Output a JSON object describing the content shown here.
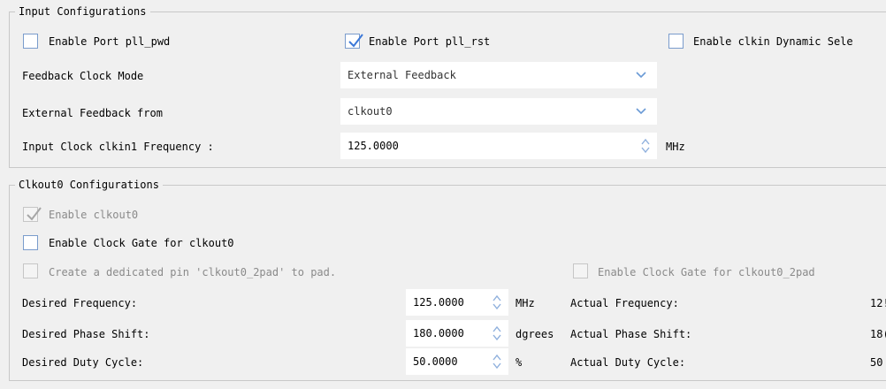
{
  "input_config": {
    "title": "Input Configurations",
    "enable_pll_pwd": {
      "label": "Enable Port pll_pwd",
      "checked": false
    },
    "enable_pll_rst": {
      "label": "Enable Port pll_rst",
      "checked": true
    },
    "enable_clkin_dyn": {
      "label": "Enable clkin Dynamic Sele",
      "checked": false
    },
    "feedback_mode_label": "Feedback Clock Mode",
    "feedback_mode_value": "External Feedback",
    "ext_feedback_label": "External Feedback from",
    "ext_feedback_value": "clkout0",
    "clkin1_freq_label": "Input Clock clkin1 Frequency :",
    "clkin1_freq_value": "125.0000",
    "clkin1_freq_unit": "MHz"
  },
  "clkout0_config": {
    "title": "Clkout0 Configurations",
    "enable_clkout0": {
      "label": "Enable clkout0",
      "checked": true,
      "disabled": true
    },
    "enable_clock_gate": {
      "label": "Enable Clock Gate for clkout0",
      "checked": false
    },
    "dedicated_pin": {
      "label": "Create a dedicated pin 'clkout0_2pad' to pad.",
      "checked": false,
      "disabled": true
    },
    "clock_gate_2pad": {
      "label": "Enable Clock Gate for clkout0_2pad",
      "checked": false,
      "disabled": true
    },
    "desired_freq_label": "Desired Frequency:",
    "desired_freq_value": "125.0000",
    "desired_freq_unit": "MHz",
    "actual_freq_label": "Actual Frequency:",
    "actual_freq_value": "12!",
    "desired_phase_label": "Desired Phase Shift:",
    "desired_phase_value": "180.0000",
    "desired_phase_unit": "dgrees",
    "actual_phase_label": "Actual Phase Shift:",
    "actual_phase_value": "18(",
    "desired_duty_label": "Desired Duty Cycle:",
    "desired_duty_value": "50.0000",
    "desired_duty_unit": "%",
    "actual_duty_label": "Actual Duty Cycle:",
    "actual_duty_value": "50"
  },
  "icons": {
    "check": "checkmark-icon",
    "chevron": "chevron-down-icon",
    "spin": "spin-up-down-icon"
  },
  "colors": {
    "checkbox_border": "#7a9ccc",
    "checkmark": "#3b78d8",
    "disabled_text": "#8a8a8a",
    "spin_arrow": "#8fb0dd"
  }
}
